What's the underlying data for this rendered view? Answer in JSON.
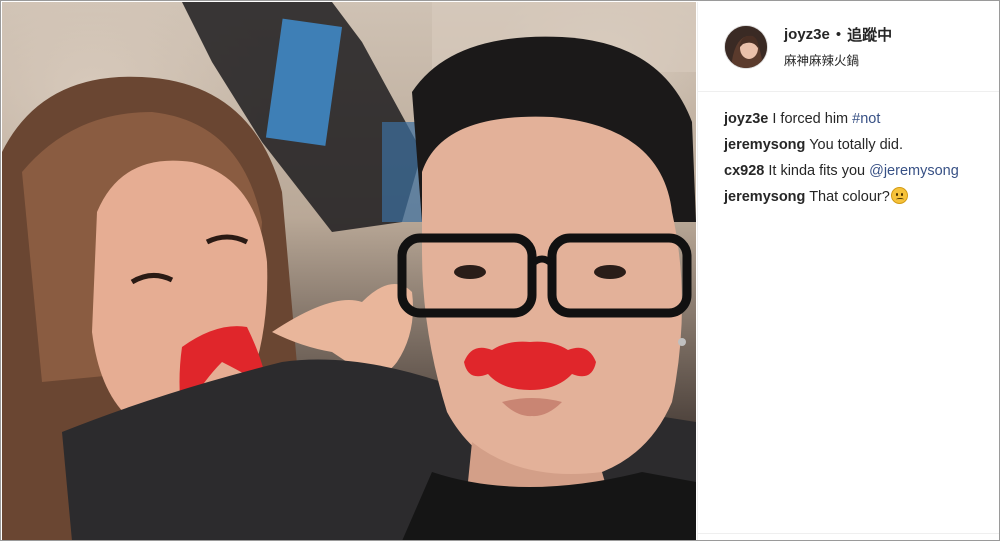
{
  "post": {
    "author": {
      "username": "joyz3e",
      "separator": "•",
      "follow_state": "追蹤中",
      "location": "麻神麻辣火鍋"
    },
    "comments": [
      {
        "user": "joyz3e",
        "text": "I forced him ",
        "link": "#not"
      },
      {
        "user": "jeremysong",
        "text": "You totally did.",
        "link": ""
      },
      {
        "user": "cx928",
        "text": "It kinda fits you ",
        "link": "@jeremysong"
      },
      {
        "user": "jeremysong",
        "text": "That colour?",
        "emoji": "confused-face-emoji"
      }
    ]
  },
  "colors": {
    "link": "#385185",
    "mustache": "#e0262b",
    "divider": "#efefef"
  }
}
